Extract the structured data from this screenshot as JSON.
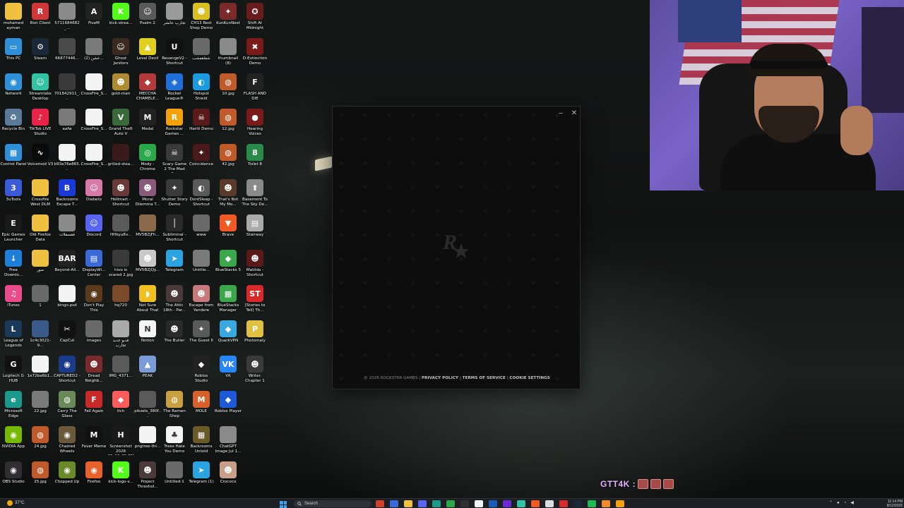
{
  "desktop": {
    "icons": [
      {
        "label": "mohamed ayman",
        "glyph": "",
        "color": "#f0c040",
        "icon": "folder-icon"
      },
      {
        "label": "Riot Client",
        "glyph": "R",
        "color": "#d13639",
        "icon": "riot-icon"
      },
      {
        "label": "5711684682_...",
        "glyph": "",
        "color": "#8a8a8a",
        "icon": "image-icon"
      },
      {
        "label": "FiveM",
        "glyph": "A",
        "color": "#222222",
        "icon": "fivem-icon"
      },
      {
        "label": "kick-strea...",
        "glyph": "K",
        "color": "#53fc18",
        "icon": "kick-icon"
      },
      {
        "label": "Psalm 2",
        "glyph": "☺",
        "color": "#5a5a5a",
        "icon": "game-icon"
      },
      {
        "label": "تجارب عائشر",
        "glyph": "",
        "color": "#9a9a9a",
        "icon": "image-icon"
      },
      {
        "label": "CH13 Rest Shop Demo",
        "glyph": "☻",
        "color": "#d8c020",
        "icon": "game-icon"
      },
      {
        "label": "KunKunNest",
        "glyph": "✦",
        "color": "#7a2a2a",
        "icon": "game-icon"
      },
      {
        "label": "Shift At Midnight",
        "glyph": "✪",
        "color": "#6a1b1b",
        "icon": "game-icon"
      },
      {
        "label": "This PC",
        "glyph": "▭",
        "color": "#2f8fd8",
        "icon": "computer-icon"
      },
      {
        "label": "Steam",
        "glyph": "⚙",
        "color": "#1b2838",
        "icon": "steam-icon"
      },
      {
        "label": "66877446...",
        "glyph": "",
        "color": "#4a4a4a",
        "icon": "image-icon"
      },
      {
        "label": "عشن (2)...",
        "glyph": "",
        "color": "#7a7a7a",
        "icon": "image-icon"
      },
      {
        "label": "Ghost Janitors",
        "glyph": "☺",
        "color": "#3a2a20",
        "icon": "game-icon"
      },
      {
        "label": "Level Devil",
        "glyph": "▲",
        "color": "#e0d020",
        "icon": "game-icon"
      },
      {
        "label": "RevengeV2 - Shortcut",
        "glyph": "U",
        "color": "#111111",
        "icon": "unreal-icon"
      },
      {
        "label": "شفلقفشب",
        "glyph": "",
        "color": "#6a6a6a",
        "icon": "image-icon"
      },
      {
        "label": "thumbnail (8)",
        "glyph": "",
        "color": "#8a8a8a",
        "icon": "image-icon"
      },
      {
        "label": "D-Extinction Demo",
        "glyph": "✖",
        "color": "#7a1a1a",
        "icon": "game-icon"
      },
      {
        "label": "Network",
        "glyph": "◉",
        "color": "#2f8fd8",
        "icon": "network-icon"
      },
      {
        "label": "Streamlabs Desktop",
        "glyph": "☺",
        "color": "#31c3a2",
        "icon": "streamlabs-icon"
      },
      {
        "label": "701842911_...",
        "glyph": "",
        "color": "#3a3a3a",
        "icon": "image-icon"
      },
      {
        "label": "CrossFire_S...",
        "glyph": "",
        "color": "#f4f4f4",
        "icon": "file-icon"
      },
      {
        "label": "gold-man",
        "glyph": "☻",
        "color": "#b08a30",
        "icon": "image-icon"
      },
      {
        "label": "MECCHA CHAMELE...",
        "glyph": "◆",
        "color": "#b33a3a",
        "icon": "game-icon"
      },
      {
        "label": "Rocket League®",
        "glyph": "◈",
        "color": "#1e6fd9",
        "icon": "rocket-league-icon"
      },
      {
        "label": "Hotspot Shield",
        "glyph": "◐",
        "color": "#1a9be0",
        "icon": "hotspot-icon"
      },
      {
        "label": "10.jpg",
        "glyph": "◍",
        "color": "#c05a2a",
        "icon": "image-icon"
      },
      {
        "label": "FLASH AND DIE",
        "glyph": "F",
        "color": "#222222",
        "icon": "game-icon"
      },
      {
        "label": "Recycle Bin",
        "glyph": "♻",
        "color": "#5a7a9a",
        "icon": "recycle-bin-icon"
      },
      {
        "label": "TikTok LIVE Studio",
        "glyph": "♪",
        "color": "#e8234a",
        "icon": "tiktok-icon"
      },
      {
        "label": "aafw",
        "glyph": "",
        "color": "#7a7a7a",
        "icon": "image-icon"
      },
      {
        "label": "CrossFire_S...",
        "glyph": "",
        "color": "#f4f4f4",
        "icon": "file-icon"
      },
      {
        "label": "Grand Theft Auto V",
        "glyph": "V",
        "color": "#3a6a3a",
        "icon": "gta-icon"
      },
      {
        "label": "Medal",
        "glyph": "M",
        "color": "#222222",
        "icon": "medal-icon"
      },
      {
        "label": "Rockstar Games ...",
        "glyph": "R",
        "color": "#f3a10b",
        "icon": "rockstar-icon"
      },
      {
        "label": "Hariti Demo",
        "glyph": "☠",
        "color": "#5a1a1a",
        "icon": "game-icon"
      },
      {
        "label": "12.jpg",
        "glyph": "◍",
        "color": "#c05a2a",
        "icon": "image-icon"
      },
      {
        "label": "Hearing Voices",
        "glyph": "●",
        "color": "#7a1a1a",
        "icon": "game-icon"
      },
      {
        "label": "Control Panel",
        "glyph": "▦",
        "color": "#2f8fd8",
        "icon": "control-panel-icon"
      },
      {
        "label": "Voicemod V3",
        "glyph": "∿",
        "color": "#0a0a0a",
        "icon": "voicemod-icon"
      },
      {
        "label": "b93e76e865...",
        "glyph": "",
        "color": "#f4f4f4",
        "icon": "file-icon"
      },
      {
        "label": "CrossFire_S...",
        "glyph": "",
        "color": "#f4f4f4",
        "icon": "file-icon"
      },
      {
        "label": "grilled-stea...",
        "glyph": "",
        "color": "#3a1a1a",
        "icon": "image-icon"
      },
      {
        "label": "Mody - Chrome",
        "glyph": "◎",
        "color": "#2aa84a",
        "icon": "chrome-icon"
      },
      {
        "label": "Scary Game 2 The Mad S...",
        "glyph": "☠",
        "color": "#3a3a3a",
        "icon": "game-icon"
      },
      {
        "label": "Coincidence",
        "glyph": "✦",
        "color": "#4a1a1a",
        "icon": "game-icon"
      },
      {
        "label": "42.jpg",
        "glyph": "◍",
        "color": "#c05a2a",
        "icon": "image-icon"
      },
      {
        "label": "Toilet 8",
        "glyph": "8",
        "color": "#2a8a4a",
        "icon": "game-icon"
      },
      {
        "label": "3uTools",
        "glyph": "3",
        "color": "#3a5ad8",
        "icon": "3utools-icon"
      },
      {
        "label": "Crossfire West DLM",
        "glyph": "",
        "color": "#f0c040",
        "icon": "folder-icon"
      },
      {
        "label": "Backrooms Escape T...",
        "glyph": "B",
        "color": "#1a3ad8",
        "icon": "game-icon"
      },
      {
        "label": "Diabeto",
        "glyph": "☺",
        "color": "#d87aa8",
        "icon": "game-icon"
      },
      {
        "label": "Hellmart - Shortcut",
        "glyph": "☻",
        "color": "#6a3a3a",
        "icon": "game-icon"
      },
      {
        "label": "Moral Dilemma T...",
        "glyph": "☻",
        "color": "#8a5a7a",
        "icon": "game-icon"
      },
      {
        "label": "Shutter Story Demo",
        "glyph": "✦",
        "color": "#3a3a3a",
        "icon": "game-icon"
      },
      {
        "label": "DontSleep - Shortcut",
        "glyph": "◐",
        "color": "#5a5a5a",
        "icon": "game-icon"
      },
      {
        "label": "That's Not My Mo...",
        "glyph": "☻",
        "color": "#5a3a2a",
        "icon": "game-icon"
      },
      {
        "label": "Basement To The Sky De...",
        "glyph": "⬆",
        "color": "#8a8a8a",
        "icon": "game-icon"
      },
      {
        "label": "Epic Games Launcher",
        "glyph": "E",
        "color": "#1a1a1a",
        "icon": "epic-games-icon"
      },
      {
        "label": "Old Firefox Data",
        "glyph": "",
        "color": "#f0c040",
        "icon": "folder-icon"
      },
      {
        "label": "فقسقلات",
        "glyph": "",
        "color": "#8a8a8a",
        "icon": "image-icon"
      },
      {
        "label": "Discord",
        "glyph": "☺",
        "color": "#5865f2",
        "icon": "discord-icon"
      },
      {
        "label": "HHkyu8v...",
        "glyph": "",
        "color": "#5a5a5a",
        "icon": "image-icon"
      },
      {
        "label": "MV5BZjFh...",
        "glyph": "",
        "color": "#8a6a4a",
        "icon": "image-icon"
      },
      {
        "label": "Subliminal - Shortcut",
        "glyph": "│",
        "color": "#2a2a2a",
        "icon": "game-icon"
      },
      {
        "label": "www",
        "glyph": "",
        "color": "#6a6a6a",
        "icon": "image-icon"
      },
      {
        "label": "Brave",
        "glyph": "▼",
        "color": "#f15a24",
        "icon": "brave-icon"
      },
      {
        "label": "Stairway",
        "glyph": "▤",
        "color": "#aaaaaa",
        "icon": "game-icon"
      },
      {
        "label": "Free Downlo...",
        "glyph": "↓",
        "color": "#1e7fd8",
        "icon": "download-icon"
      },
      {
        "label": "صور",
        "glyph": "",
        "color": "#f0c040",
        "icon": "folder-icon"
      },
      {
        "label": "Beyond-All...",
        "glyph": "BAR",
        "color": "#222222",
        "icon": "game-icon"
      },
      {
        "label": "DisplayWi... Center",
        "glyph": "▤",
        "color": "#3a6ad8",
        "icon": "app-icon"
      },
      {
        "label": "hivo is scared 2.jpg",
        "glyph": "",
        "color": "#3a3a3a",
        "icon": "image-icon"
      },
      {
        "label": "MV5BZjQy...",
        "glyph": "☻",
        "color": "#c8c8c8",
        "icon": "image-icon"
      },
      {
        "label": "Telegram",
        "glyph": "➤",
        "color": "#2aa3e0",
        "icon": "telegram-icon"
      },
      {
        "label": "Untitle...",
        "glyph": "",
        "color": "#7a7a7a",
        "icon": "image-icon"
      },
      {
        "label": "BlueStacks 5",
        "glyph": "◆",
        "color": "#3aa84a",
        "icon": "bluestacks-icon"
      },
      {
        "label": "Matilda - Shortcut",
        "glyph": "☻",
        "color": "#5a1a1a",
        "icon": "game-icon"
      },
      {
        "label": "iTunes",
        "glyph": "♫",
        "color": "#e84a8a",
        "icon": "itunes-icon"
      },
      {
        "label": "1",
        "glyph": "",
        "color": "#6a6a6a",
        "icon": "image-icon"
      },
      {
        "label": "bingo.psd",
        "glyph": "",
        "color": "#f4f4f4",
        "icon": "file-icon"
      },
      {
        "label": "Don't Play This",
        "glyph": "◉",
        "color": "#5a3a1a",
        "icon": "game-icon"
      },
      {
        "label": "hq720",
        "glyph": "",
        "color": "#7a4a2a",
        "icon": "image-icon"
      },
      {
        "label": "Not Sure About That",
        "glyph": "◗",
        "color": "#f0c020",
        "icon": "game-icon"
      },
      {
        "label": "The Attic 18th - Par...",
        "glyph": "☻",
        "color": "#4a3a3a",
        "icon": "game-icon"
      },
      {
        "label": "Escape from Yandere",
        "glyph": "☻",
        "color": "#c87a7a",
        "icon": "game-icon"
      },
      {
        "label": "BlueStacks Manager",
        "glyph": "▦",
        "color": "#3aa84a",
        "icon": "bluestacks-icon"
      },
      {
        "label": "[Stories to Tell] Th...",
        "glyph": "ST",
        "color": "#d82a2a",
        "icon": "game-icon"
      },
      {
        "label": "League of Legends",
        "glyph": "L",
        "color": "#1a3a5a",
        "icon": "league-icon"
      },
      {
        "label": "1c4c3021-9...",
        "glyph": "",
        "color": "#3a5a8a",
        "icon": "image-icon"
      },
      {
        "label": "CapCut",
        "glyph": "✂",
        "color": "#111111",
        "icon": "capcut-icon"
      },
      {
        "label": "images",
        "glyph": "",
        "color": "#6a6a6a",
        "icon": "image-icon"
      },
      {
        "label": "فديو جديد تجارب",
        "glyph": "",
        "color": "#aaaaaa",
        "icon": "image-icon"
      },
      {
        "label": "Notion",
        "glyph": "N",
        "color": "#f4f4f4",
        "icon": "notion-icon"
      },
      {
        "label": "The Butler",
        "glyph": "☻",
        "color": "#2a2a2a",
        "icon": "game-icon"
      },
      {
        "label": "The Guest II",
        "glyph": "✦",
        "color": "#5a5a5a",
        "icon": "game-icon"
      },
      {
        "label": "QuarkVPN",
        "glyph": "◆",
        "color": "#3aa8e0",
        "icon": "vpn-icon"
      },
      {
        "label": "Photomaly",
        "glyph": "P",
        "color": "#e0c040",
        "icon": "game-icon"
      },
      {
        "label": "Logitech G HUB",
        "glyph": "G",
        "color": "#111111",
        "icon": "logitech-icon"
      },
      {
        "label": "1e72ba6b1...",
        "glyph": "",
        "color": "#f4f4f4",
        "icon": "file-icon"
      },
      {
        "label": "CAPTURED2 - Shortcut",
        "glyph": "◉",
        "color": "#1a3a8a",
        "icon": "game-icon"
      },
      {
        "label": "Dread Neighb...",
        "glyph": "☻",
        "color": "#7a2a2a",
        "icon": "game-icon"
      },
      {
        "label": "IMG_4371...",
        "glyph": "",
        "color": "#5a5a5a",
        "icon": "image-icon"
      },
      {
        "label": "PEAK",
        "glyph": "▲",
        "color": "#7a9ad8",
        "icon": "game-icon"
      },
      {
        "label": "",
        "glyph": "",
        "color": "transparent",
        "icon": "empty-slot"
      },
      {
        "label": "Roblox Studio",
        "glyph": "◆",
        "color": "#222222",
        "icon": "roblox-studio-icon"
      },
      {
        "label": "VK",
        "glyph": "VK",
        "color": "#2787f5",
        "icon": "vk-icon"
      },
      {
        "label": "Writer. Chapter 1",
        "glyph": "☻",
        "color": "#3a3a3a",
        "icon": "game-icon"
      },
      {
        "label": "Microsoft Edge",
        "glyph": "e",
        "color": "#1a9a8a",
        "icon": "edge-icon"
      },
      {
        "label": "22.jpg",
        "glyph": "",
        "color": "#7a7a7a",
        "icon": "image-icon"
      },
      {
        "label": "Carry The Glass",
        "glyph": "◍",
        "color": "#6a8a5a",
        "icon": "game-icon"
      },
      {
        "label": "Fall Again",
        "glyph": "F",
        "color": "#c82a2a",
        "icon": "game-icon"
      },
      {
        "label": "itch",
        "glyph": "◆",
        "color": "#fa5c5c",
        "icon": "itch-icon"
      },
      {
        "label": "pikzels_380f...",
        "glyph": "",
        "color": "#5a5a5a",
        "icon": "image-icon"
      },
      {
        "label": "The Ramen Shop",
        "glyph": "◍",
        "color": "#c8a040",
        "icon": "game-icon"
      },
      {
        "label": "MOLE",
        "glyph": "M",
        "color": "#d8602a",
        "icon": "game-icon"
      },
      {
        "label": "Roblox Player",
        "glyph": "◆",
        "color": "#1e5ad8",
        "icon": "roblox-icon"
      },
      {
        "label": "",
        "glyph": "",
        "color": "transparent",
        "icon": "empty-slot"
      },
      {
        "label": "NVIDIA App",
        "glyph": "◉",
        "color": "#76b900",
        "icon": "nvidia-icon"
      },
      {
        "label": "24.jpg",
        "glyph": "◍",
        "color": "#c05a2a",
        "icon": "image-icon"
      },
      {
        "label": "Chained Wheels",
        "glyph": "◉",
        "color": "#6a5a3a",
        "icon": "game-icon"
      },
      {
        "label": "Fever Meme",
        "glyph": "M",
        "color": "#111111",
        "icon": "game-icon"
      },
      {
        "label": "Screenshot 2026 05_13_35 PM",
        "glyph": "H",
        "color": "#1a1a1a",
        "icon": "image-icon"
      },
      {
        "label": "pngtree-thi...",
        "glyph": "",
        "color": "#f4f4f4",
        "icon": "image-icon"
      },
      {
        "label": "Trees Hate You Demo",
        "glyph": "♣",
        "color": "#f4f4f4",
        "icon": "game-icon"
      },
      {
        "label": "Backrooms Untold",
        "glyph": "▦",
        "color": "#6a5a2a",
        "icon": "game-icon"
      },
      {
        "label": "ChatGPT Image Jul 1...",
        "glyph": "",
        "color": "#8a8a8a",
        "icon": "image-icon"
      },
      {
        "label": "",
        "glyph": "",
        "color": "transparent",
        "icon": "empty-slot"
      },
      {
        "label": "OBS Studio",
        "glyph": "◉",
        "color": "#302e31",
        "icon": "obs-icon"
      },
      {
        "label": "25.jpg",
        "glyph": "◍",
        "color": "#c05a2a",
        "icon": "image-icon"
      },
      {
        "label": "Chopped Up",
        "glyph": "◉",
        "color": "#6a8a2a",
        "icon": "game-icon"
      },
      {
        "label": "Firefox",
        "glyph": "◉",
        "color": "#e8602a",
        "icon": "firefox-icon"
      },
      {
        "label": "kick-logo-v...",
        "glyph": "K",
        "color": "#53fc18",
        "icon": "kick-icon"
      },
      {
        "label": "Project Threshol...",
        "glyph": "☻",
        "color": "#4a3a3a",
        "icon": "game-icon"
      },
      {
        "label": "Untitled-1",
        "glyph": "",
        "color": "#6a6a6a",
        "icon": "image-icon"
      },
      {
        "label": "Telegram (1)",
        "glyph": "➤",
        "color": "#2aa3e0",
        "icon": "telegram-icon"
      },
      {
        "label": "Crococo",
        "glyph": "☻",
        "color": "#c8a08a",
        "icon": "game-icon"
      },
      {
        "label": "",
        "glyph": "",
        "color": "transparent",
        "icon": "empty-slot"
      }
    ]
  },
  "launcher": {
    "copyright": "© 2026 ROCKSTAR GAMES",
    "sep": "|",
    "privacy": "PRIVACY POLICY",
    "terms": "TERMS OF SERVICE",
    "cookies": "COOKIE SETTINGS",
    "minimize_glyph": "–",
    "close_glyph": "✕"
  },
  "overlay": {
    "chat_name": "GTT4K :"
  },
  "taskbar": {
    "weather_temp": "37°C",
    "search_placeholder": "Search",
    "clock_time": "11:14 PM",
    "clock_date": "8/12/2026",
    "apps": [
      {
        "icon": "browser-icon",
        "color": "#d0402a"
      },
      {
        "icon": "file-icon",
        "color": "#3a6ad8"
      },
      {
        "icon": "folder-icon",
        "color": "#f0c040"
      },
      {
        "icon": "discord-icon",
        "color": "#5865f2"
      },
      {
        "icon": "edge-icon",
        "color": "#1a9a8a"
      },
      {
        "icon": "chrome-icon",
        "color": "#2aa84a"
      },
      {
        "icon": "obs-icon",
        "color": "#302e31"
      },
      {
        "icon": "notion-icon",
        "color": "#f4f4f4"
      },
      {
        "icon": "photoshop-icon",
        "color": "#1a5ab8"
      },
      {
        "icon": "premiere-icon",
        "color": "#6a2ad8"
      },
      {
        "icon": "streamlabs-icon",
        "color": "#31c3a2"
      },
      {
        "icon": "brave-icon",
        "color": "#f15a24"
      },
      {
        "icon": "notion-icon",
        "color": "#dddddd"
      },
      {
        "icon": "media-icon",
        "color": "#d82a2a"
      },
      {
        "icon": "steam-icon",
        "color": "#1b2838"
      },
      {
        "icon": "spotify-icon",
        "color": "#1db954"
      },
      {
        "icon": "fivem-icon",
        "color": "#f08a2a"
      },
      {
        "icon": "rockstar-icon",
        "color": "#f3a10b"
      }
    ]
  }
}
